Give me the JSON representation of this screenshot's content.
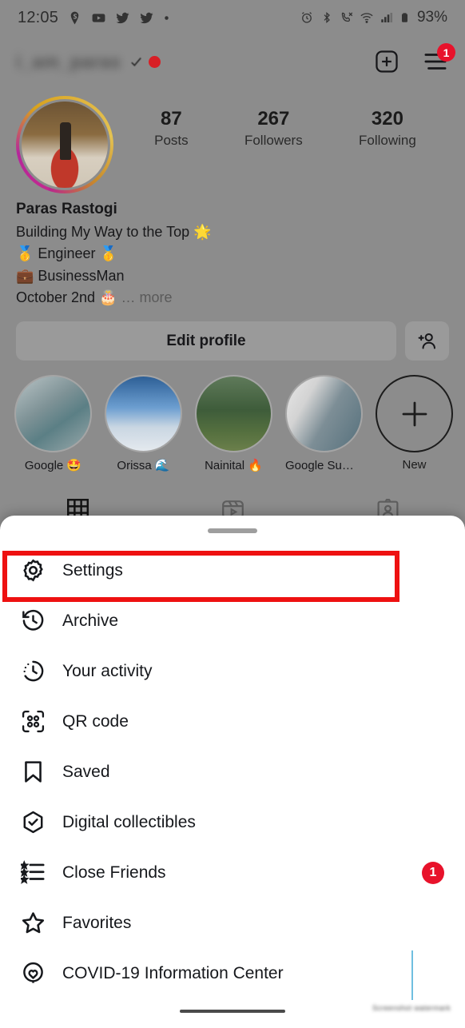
{
  "status_bar": {
    "time": "12:05",
    "left_icons": [
      "location-pin-icon",
      "youtube-icon",
      "twitter-icon",
      "twitter-icon",
      "dot-icon"
    ],
    "right_icons": [
      "alarm-icon",
      "bluetooth-icon",
      "call-mute-icon",
      "wifi-icon",
      "cellular-signal-icon",
      "battery-icon"
    ],
    "battery_percent": "93%"
  },
  "profile": {
    "username": "i_am_paras",
    "verified_icon": "verified-tick-icon",
    "status_dot_color": "#d81f26",
    "add_post_icon": "plus-square-icon",
    "menu_icon": "hamburger-menu-icon",
    "menu_badge": "1",
    "avatar_icon": "profile-avatar",
    "stats": [
      {
        "value": "87",
        "label": "Posts"
      },
      {
        "value": "267",
        "label": "Followers"
      },
      {
        "value": "320",
        "label": "Following"
      }
    ],
    "bio": {
      "name": "Paras Rastogi",
      "line1": "Building My Way to the Top 🌟",
      "line2": "🥇 Engineer 🥇",
      "line3": "💼 BusinessMan",
      "line4": "October 2nd 🎂",
      "more_label": "… more"
    },
    "edit_profile_label": "Edit profile",
    "add_person_icon": "add-person-icon",
    "highlights": [
      {
        "label": "Google 🤩"
      },
      {
        "label": "Orissa 🌊"
      },
      {
        "label": "Nainital 🔥"
      },
      {
        "label": "Google Summit❤️"
      },
      {
        "label": "New",
        "icon": "plus-icon"
      }
    ],
    "tabs": [
      {
        "icon": "grid-icon",
        "active": true
      },
      {
        "icon": "reels-icon",
        "active": false
      },
      {
        "icon": "tagged-icon",
        "active": false
      }
    ]
  },
  "sheet": {
    "handle_icon": "drag-handle",
    "menu_items": [
      {
        "icon": "settings-gear-icon",
        "label": "Settings",
        "highlighted": true
      },
      {
        "icon": "archive-clock-icon",
        "label": "Archive"
      },
      {
        "icon": "your-activity-icon",
        "label": "Your activity"
      },
      {
        "icon": "qr-code-icon",
        "label": "QR code"
      },
      {
        "icon": "bookmark-icon",
        "label": "Saved"
      },
      {
        "icon": "shield-check-icon",
        "label": "Digital collectibles"
      },
      {
        "icon": "star-list-icon",
        "label": "Close Friends",
        "badge": "1"
      },
      {
        "icon": "star-icon",
        "label": "Favorites"
      },
      {
        "icon": "covid-heart-icon",
        "label": "COVID-19 Information Center"
      }
    ]
  },
  "annotation": {
    "highlight_color": "#ee1111",
    "target": "Settings"
  },
  "bottom_nav": {
    "home_indicator": "nav-pill"
  }
}
